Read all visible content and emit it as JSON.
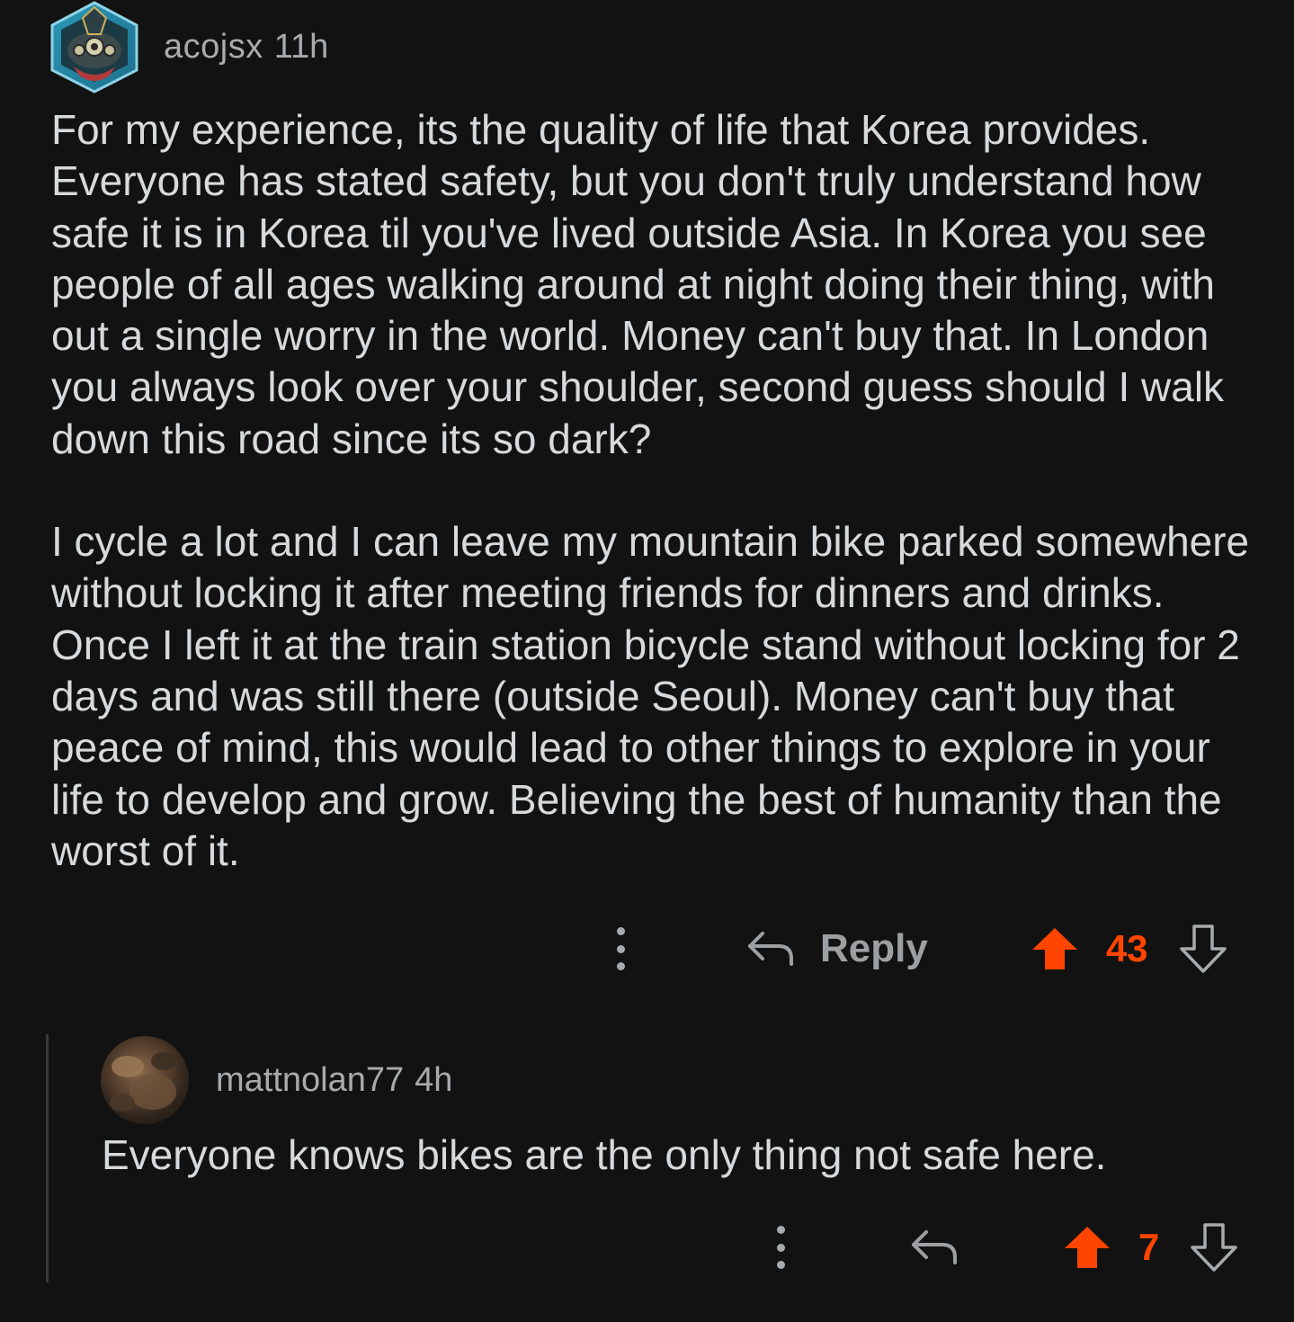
{
  "comment": {
    "author": "acojsx",
    "age": "11h",
    "body_paragraphs": [
      "For my experience, its the quality of life that Korea provides. Everyone has stated safety, but you don't truly understand how safe it is in Korea til you've lived outside Asia. In Korea you see people of all ages walking around at night doing their thing, with out a single worry in the world. Money can't buy that. In London you always look over your shoulder, second guess should I walk down this road since its so dark?",
      "I cycle a lot and I can leave my mountain bike parked somewhere without locking it after meeting friends for dinners and drinks. Once I left it at the train station bicycle stand without locking for 2 days and was still there (outside Seoul). Money can't buy that peace of mind, this would lead to other things to explore in your life to develop and grow. Believing the best of humanity than the worst of it."
    ],
    "reply_label": "Reply",
    "vote_count": "43",
    "upvoted": true,
    "icons": [
      "kebab-menu-icon",
      "reply-arrow-icon",
      "upvote-arrow-icon",
      "downvote-arrow-icon"
    ]
  },
  "reply": {
    "author": "mattnolan77",
    "age": "4h",
    "body": "Everyone knows bikes are the only thing not safe here.",
    "vote_count": "7",
    "upvoted": true,
    "icons": [
      "kebab-menu-icon",
      "reply-arrow-icon",
      "upvote-arrow-icon",
      "downvote-arrow-icon"
    ]
  },
  "colors": {
    "background": "#121212",
    "text": "#d7dadc",
    "meta": "#a8abad",
    "upvote": "#ff4500",
    "thread_line": "#3a3a3c"
  }
}
